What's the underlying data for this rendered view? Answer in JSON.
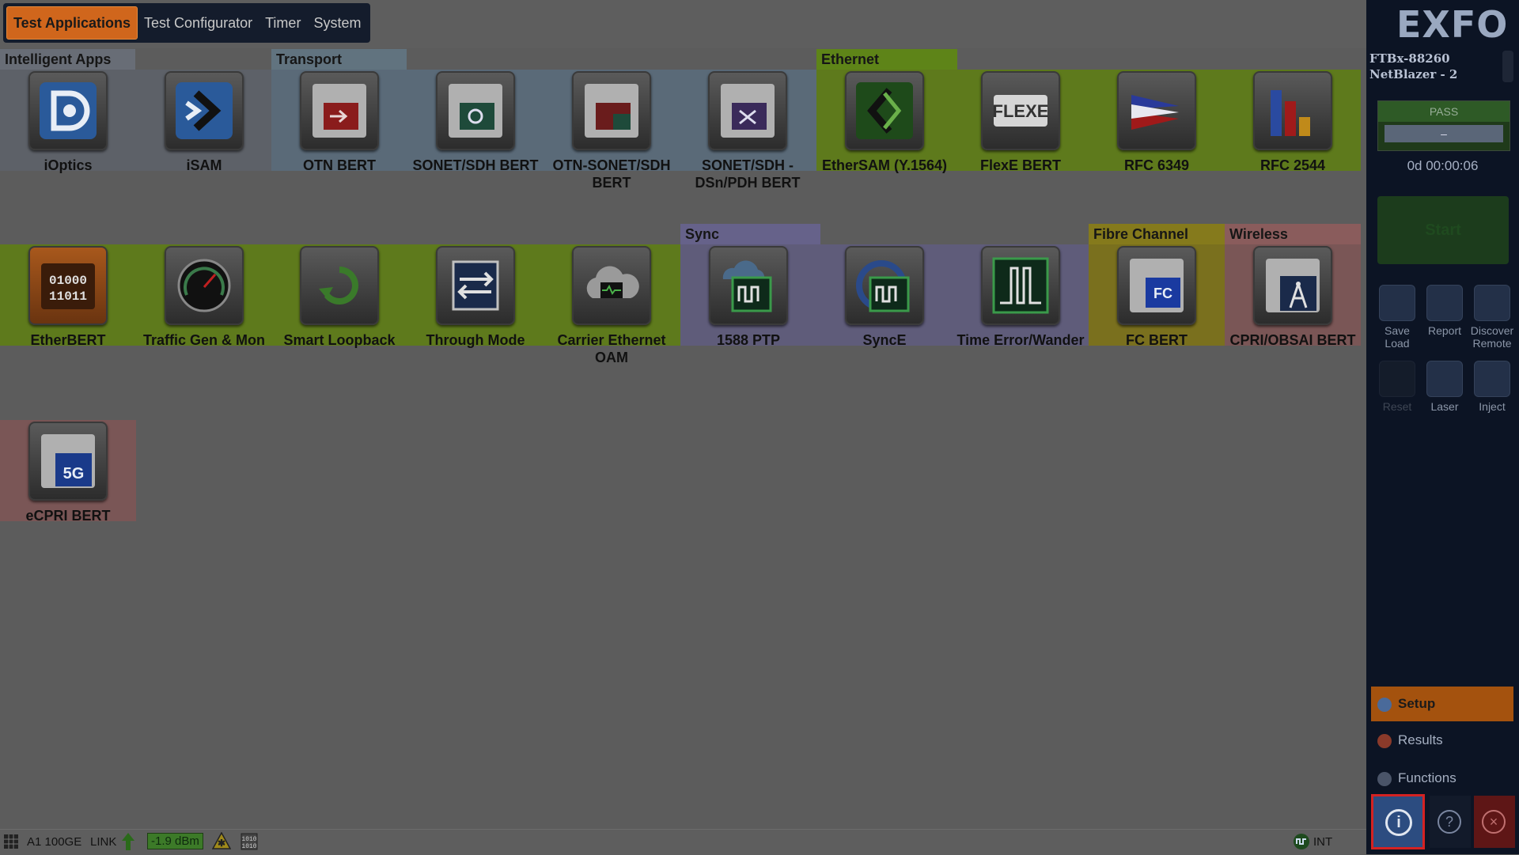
{
  "tabs": [
    "Test Applications",
    "Test Configurator",
    "Timer",
    "System"
  ],
  "groups": {
    "intelligent": "Intelligent Apps",
    "transport": "Transport",
    "ethernet": "Ethernet",
    "sync": "Sync",
    "fibre": "Fibre Channel",
    "wireless": "Wireless"
  },
  "apps": {
    "ioptics": "iOptics",
    "isam": "iSAM",
    "otn_bert": "OTN BERT",
    "sonet_sdh_bert": "SONET/SDH BERT",
    "otn_sonet_sdh_bert": "OTN-SONET/SDH BERT",
    "sonet_dsn_pdh": "SONET/SDH - DSn/PDH BERT",
    "ethersam": "EtherSAM (Y.1564)",
    "flexe_bert": "FlexE BERT",
    "rfc6349": "RFC 6349",
    "rfc2544": "RFC 2544",
    "etherbert": "EtherBERT",
    "traffic_gen": "Traffic Gen & Mon",
    "smart_loopback": "Smart Loopback",
    "through_mode": "Through Mode",
    "carrier_eth_oam": "Carrier Ethernet OAM",
    "ptp_1588": "1588 PTP",
    "synce": "SyncE",
    "time_error": "Time Error/Wander",
    "fc_bert": "FC BERT",
    "cpri_bert": "CPRI/OBSAI BERT",
    "ecpri_bert": "eCPRI BERT"
  },
  "panel": {
    "logo": "EXFO",
    "model_line1": "FTBx-88260",
    "model_line2": "NetBlazer - 2",
    "pass": "PASS",
    "dash": "–",
    "timer": "0d 00:00:06",
    "start": "Start",
    "tools": {
      "save_load": "Save Load",
      "report": "Report",
      "discover": "Discover Remote",
      "reset": "Reset",
      "laser": "Laser",
      "inject": "Inject"
    },
    "nav": {
      "setup": "Setup",
      "results": "Results",
      "functions": "Functions"
    }
  },
  "status": {
    "port": "A1 100GE",
    "link": "LINK",
    "power": "-1.9 dBm",
    "clock": "INT"
  },
  "colors": {
    "tab_active": "#d0661c",
    "band_intelligent": "#5d6168",
    "band_transport": "#5a6a78",
    "band_ethernet": "#5e7a1c",
    "band_sync": "#5f5c7a",
    "band_fibre": "#7a701e",
    "band_wireless": "#7a5656",
    "power_badge": "#3c7a28"
  }
}
